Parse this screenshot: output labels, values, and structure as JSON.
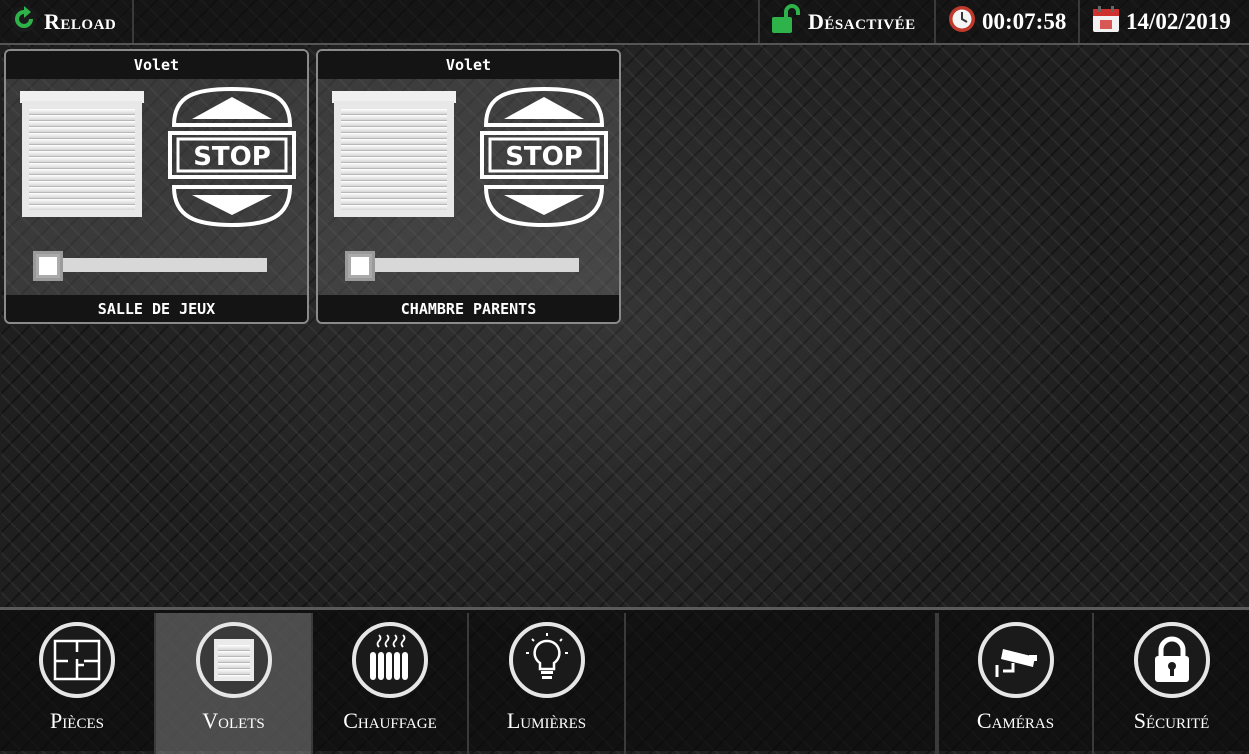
{
  "topbar": {
    "reload_label": "Reload",
    "alarm_label": "Désactivée",
    "time": "00:07:58",
    "date": "14/02/2019"
  },
  "cards": [
    {
      "type": "Volet",
      "room": "SALLE DE JEUX",
      "stop_label": "STOP",
      "position_percent": 0
    },
    {
      "type": "Volet",
      "room": "CHAMBRE PARENTS",
      "stop_label": "STOP",
      "position_percent": 0
    }
  ],
  "nav": {
    "active": "Volets",
    "items": [
      {
        "label": "Pièces",
        "icon": "floorplan-icon"
      },
      {
        "label": "Volets",
        "icon": "shutter-icon"
      },
      {
        "label": "Chauffage",
        "icon": "radiator-icon"
      },
      {
        "label": "Lumières",
        "icon": "lightbulb-icon"
      },
      {
        "label": "Caméras",
        "icon": "camera-icon"
      },
      {
        "label": "Sécurité",
        "icon": "padlock-icon"
      }
    ]
  },
  "colors": {
    "reload_green": "#2db34a",
    "unlock_green": "#2db34a",
    "clock_red": "#c0392b",
    "calendar_red": "#d0312d"
  }
}
